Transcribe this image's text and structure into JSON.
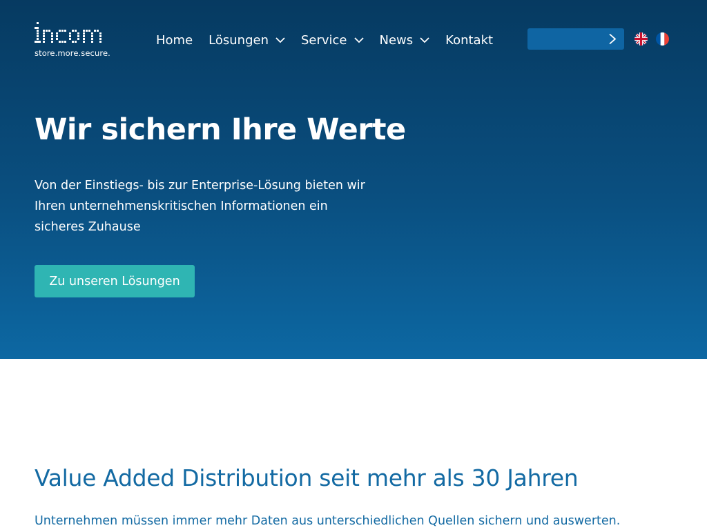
{
  "header": {
    "logo_alt": "incom",
    "logo_tagline": "store.more.secure.",
    "nav": [
      {
        "label": "Home",
        "has_dropdown": false
      },
      {
        "label": "Lösungen",
        "has_dropdown": true
      },
      {
        "label": "Service",
        "has_dropdown": true
      },
      {
        "label": "News",
        "has_dropdown": true
      },
      {
        "label": "Kontakt",
        "has_dropdown": false
      }
    ],
    "search": {
      "value": "",
      "placeholder": ""
    },
    "languages": [
      "English",
      "Français"
    ]
  },
  "hero": {
    "title": "Wir sichern Ihre Werte",
    "text": "Von der Einstiegs- bis zur Enterprise-Lösung bieten wir Ihren unternehmenskritischen Informationen ein sicheres Zuhause",
    "cta_label": "Zu unseren Lösungen"
  },
  "section": {
    "title": "Value Added Distribution seit mehr als 30 Jahren",
    "text": "Unternehmen müssen immer mehr Daten aus unterschiedlichen Quellen sichern und auswerten."
  },
  "colors": {
    "hero_top": "#063a61",
    "hero_bottom": "#0d68a3",
    "accent_button": "#2fb5b3",
    "heading_blue": "#136aa3"
  },
  "icons": {
    "dropdown": "chevron-down-icon",
    "search_submit": "chevron-right-icon",
    "flag_en": "uk-flag-icon",
    "flag_fr": "france-flag-icon"
  }
}
